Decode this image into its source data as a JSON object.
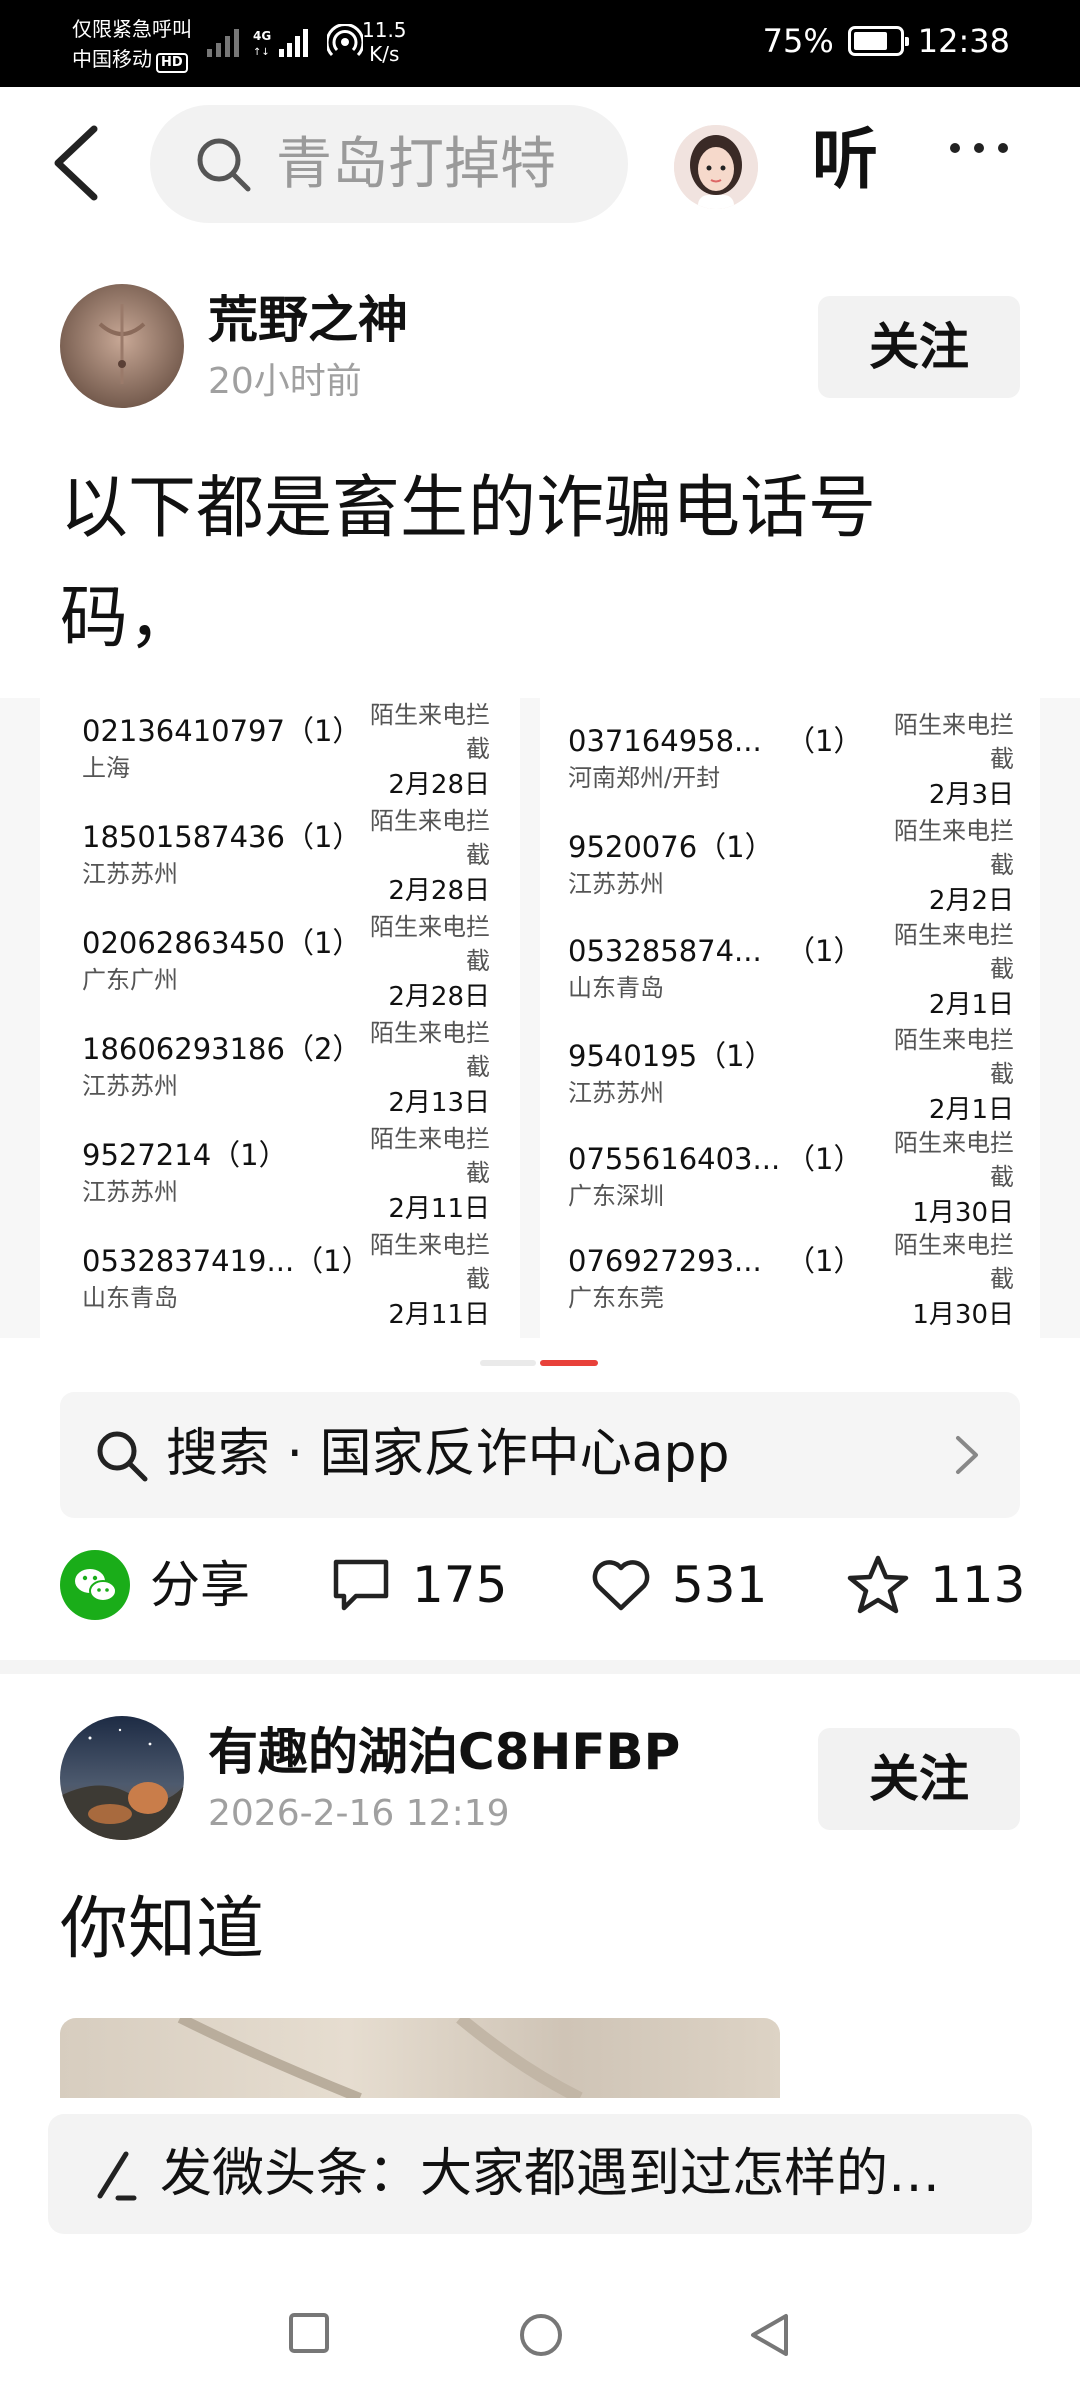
{
  "status_bar": {
    "line1": "仅限紧急呼叫",
    "line2": "中国移动",
    "hd": "HD",
    "net_speed_value": "11.5",
    "net_speed_unit": "K/s",
    "battery": "75%",
    "battery_level": 0.75,
    "time": "12:38"
  },
  "nav": {
    "search_text": "青岛打掉特",
    "listen_label": "听"
  },
  "post1": {
    "author": "荒野之神",
    "time": "20小时前",
    "follow_label": "关注",
    "title": "以下都是畜生的诈骗电话号码，",
    "records_left": [
      {
        "number": "02136410797（1）",
        "location": "上海",
        "tag": "陌生来电拦截",
        "date": "2月28日"
      },
      {
        "number": "18501587436（1）",
        "location": "江苏苏州",
        "tag": "陌生来电拦截",
        "date": "2月28日"
      },
      {
        "number": "02062863450（1）",
        "location": "广东广州",
        "tag": "陌生来电拦截",
        "date": "2月28日"
      },
      {
        "number": "18606293186（2）",
        "location": "江苏苏州",
        "tag": "陌生来电拦截",
        "date": "2月13日"
      },
      {
        "number": "9527214（1）",
        "location": "江苏苏州",
        "tag": "陌生来电拦截",
        "date": "2月11日"
      },
      {
        "number": "0532837419...（1）",
        "location": "山东青岛",
        "tag": "陌生来电拦截",
        "date": "2月11日"
      }
    ],
    "records_right": [
      {
        "number": "037164958...",
        "count": "（1）",
        "location": "河南郑州/开封",
        "tag": "陌生来电拦截",
        "date": "2月3日"
      },
      {
        "number": "9520076（1）",
        "count": "",
        "location": "江苏苏州",
        "tag": "陌生来电拦截",
        "date": "2月2日"
      },
      {
        "number": "053285874...",
        "count": "（1）",
        "location": "山东青岛",
        "tag": "陌生来电拦截",
        "date": "2月1日"
      },
      {
        "number": "9540195（1）",
        "count": "",
        "location": "江苏苏州",
        "tag": "陌生来电拦截",
        "date": "2月1日"
      },
      {
        "number": "0755616403...",
        "count": "（1）",
        "location": "广东深圳",
        "tag": "陌生来电拦截",
        "date": "1月30日"
      },
      {
        "number": "076927293...",
        "count": "（1）",
        "location": "广东东莞",
        "tag": "陌生来电拦截",
        "date": "1月30日"
      }
    ],
    "search_card": "搜索 · 国家反诈中心app",
    "share_label": "分享",
    "comments": "175",
    "likes": "531",
    "favorites": "113"
  },
  "post2": {
    "author": "有趣的湖泊C8HFBP",
    "time": "2026-2-16 12:19",
    "follow_label": "关注",
    "title": "你知道"
  },
  "compose": {
    "text": "发微头条：大家都遇到过怎样的…"
  },
  "colors": {
    "accent_red": "#e8413a",
    "wechat_green": "#1aad19"
  }
}
